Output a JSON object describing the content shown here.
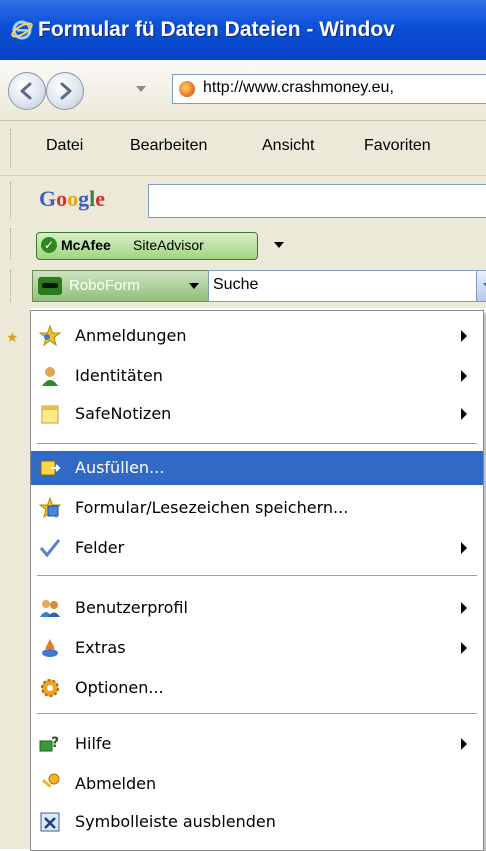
{
  "window": {
    "title": "Formular fü Daten Dateien - Windov"
  },
  "address": {
    "url": "http://www.crashmoney.eu,"
  },
  "menubar": {
    "items": [
      "Datei",
      "Bearbeiten",
      "Ansicht",
      "Favoriten"
    ]
  },
  "google": {
    "logo": "Google"
  },
  "mcafee": {
    "brand": "McAfee",
    "product": "SiteAdvisor"
  },
  "roboform": {
    "button_label": "RoboForm",
    "search_label": "Suche"
  },
  "menu": {
    "items": [
      {
        "label": "Anmeldungen",
        "icon": "star-people-icon",
        "submenu": true
      },
      {
        "label": "Identitäten",
        "icon": "identity-person-icon",
        "submenu": true
      },
      {
        "label": "SafeNotizen",
        "icon": "note-icon",
        "submenu": true
      },
      {
        "label": "Ausfüllen...",
        "icon": "fill-form-icon",
        "submenu": false,
        "highlighted": true
      },
      {
        "label": "Formular/Lesezeichen speichern...",
        "icon": "save-form-icon",
        "submenu": false
      },
      {
        "label": "Felder",
        "icon": "checkmark-icon",
        "submenu": true
      },
      {
        "label": "Benutzerprofil",
        "icon": "user-profile-icon",
        "submenu": true
      },
      {
        "label": "Extras",
        "icon": "extras-icon",
        "submenu": true
      },
      {
        "label": "Optionen...",
        "icon": "gear-icon",
        "submenu": false
      },
      {
        "label": "Hilfe",
        "icon": "help-icon",
        "submenu": true
      },
      {
        "label": "Abmelden",
        "icon": "key-icon",
        "submenu": false
      },
      {
        "label": "Symbolleiste ausblenden",
        "icon": "close-toolbar-icon",
        "submenu": false
      }
    ]
  },
  "colors": {
    "highlight": "#316ac5",
    "titlebar": "#0a4fd6",
    "toolbar": "#ece9d8"
  }
}
